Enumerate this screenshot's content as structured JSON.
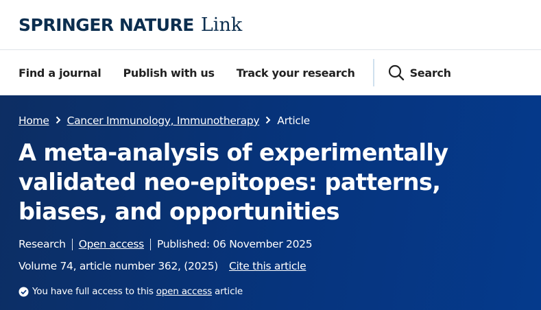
{
  "header": {
    "logo_brand": "SPRINGER NATURE",
    "logo_sub": "Link"
  },
  "nav": {
    "items": [
      "Find a journal",
      "Publish with us",
      "Track your research"
    ],
    "search_label": "Search",
    "search_icon": "search-icon"
  },
  "breadcrumb": {
    "home": "Home",
    "journal": "Cancer Immunology, Immunotherapy",
    "current": "Article",
    "separator_icon": "chevron-right-icon"
  },
  "article": {
    "title": "A meta-analysis of experimentally validated neo-epitopes: patterns, biases, and opportunities",
    "type": "Research",
    "access": "Open access",
    "published": "Published: 06 November 2025",
    "volume": "Volume 74, article number 362, (2025)",
    "cite_label": "Cite this article"
  },
  "access_notice": {
    "prefix": "You have full access to this",
    "link": "open access",
    "suffix": "article",
    "icon": "check-circle-icon"
  },
  "colors": {
    "brand": "#0b2e4f",
    "hero_bg": "#06347d",
    "divider": "#cfe0ee"
  }
}
